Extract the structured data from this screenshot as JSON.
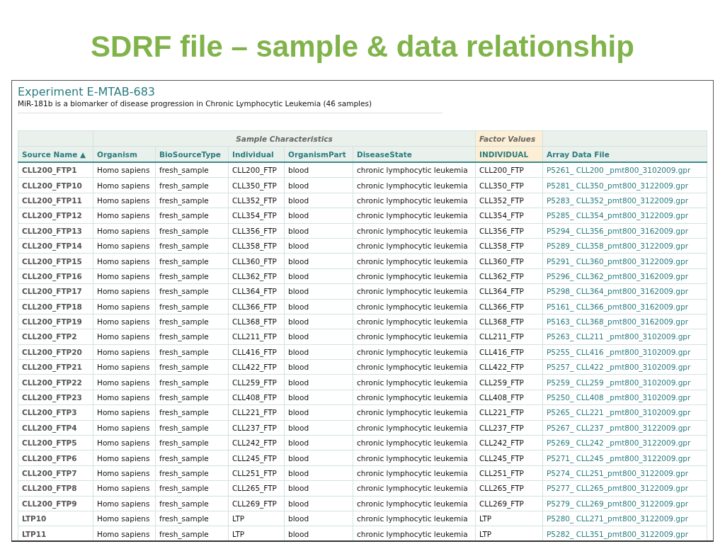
{
  "slide_title": "SDRF file – sample & data relationship",
  "experiment": {
    "title": "Experiment E-MTAB-683",
    "description": "MiR-181b is a biomarker of disease progression in Chronic Lymphocytic Leukemia (46 samples)"
  },
  "table": {
    "group_headers": [
      {
        "label": "Sample Characteristics",
        "kind": "characteristics"
      },
      {
        "label": "Factor Values",
        "kind": "factor"
      }
    ],
    "columns": [
      {
        "label": "Source Name",
        "kind": "source",
        "sort_indicator": "▲"
      },
      {
        "label": "Organism",
        "kind": "characteristics"
      },
      {
        "label": "BioSourceType",
        "kind": "characteristics"
      },
      {
        "label": "Individual",
        "kind": "characteristics"
      },
      {
        "label": "OrganismPart",
        "kind": "characteristics"
      },
      {
        "label": "DiseaseState",
        "kind": "characteristics"
      },
      {
        "label": "INDIVIDUAL",
        "kind": "factor"
      },
      {
        "label": "Array Data File",
        "kind": "file"
      }
    ],
    "rows": [
      [
        "CLL200_FTP1",
        "Homo sapiens",
        "fresh_sample",
        "CLL200_FTP",
        "blood",
        "chronic lymphocytic leukemia",
        "CLL200_FTP",
        "P5261_ CLL200 _pmt800_3102009.gpr"
      ],
      [
        "CLL200_FTP10",
        "Homo sapiens",
        "fresh_sample",
        "CLL350_FTP",
        "blood",
        "chronic lymphocytic leukemia",
        "CLL350_FTP",
        "P5281_ CLL350_pmt800_3122009.gpr"
      ],
      [
        "CLL200_FTP11",
        "Homo sapiens",
        "fresh_sample",
        "CLL352_FTP",
        "blood",
        "chronic lymphocytic leukemia",
        "CLL352_FTP",
        "P5283_ CLL352_pmt800_3122009.gpr"
      ],
      [
        "CLL200_FTP12",
        "Homo sapiens",
        "fresh_sample",
        "CLL354_FTP",
        "blood",
        "chronic lymphocytic leukemia",
        "CLL354_FTP",
        "P5285_ CLL354_pmt800_3122009.gpr"
      ],
      [
        "CLL200_FTP13",
        "Homo sapiens",
        "fresh_sample",
        "CLL356_FTP",
        "blood",
        "chronic lymphocytic leukemia",
        "CLL356_FTP",
        "P5294_ CLL356_pmt800_3162009.gpr"
      ],
      [
        "CLL200_FTP14",
        "Homo sapiens",
        "fresh_sample",
        "CLL358_FTP",
        "blood",
        "chronic lymphocytic leukemia",
        "CLL358_FTP",
        "P5289_ CLL358_pmt800_3122009.gpr"
      ],
      [
        "CLL200_FTP15",
        "Homo sapiens",
        "fresh_sample",
        "CLL360_FTP",
        "blood",
        "chronic lymphocytic leukemia",
        "CLL360_FTP",
        "P5291_ CLL360_pmt800_3122009.gpr"
      ],
      [
        "CLL200_FTP16",
        "Homo sapiens",
        "fresh_sample",
        "CLL362_FTP",
        "blood",
        "chronic lymphocytic leukemia",
        "CLL362_FTP",
        "P5296_ CLL362_pmt800_3162009.gpr"
      ],
      [
        "CLL200_FTP17",
        "Homo sapiens",
        "fresh_sample",
        "CLL364_FTP",
        "blood",
        "chronic lymphocytic leukemia",
        "CLL364_FTP",
        "P5298_ CLL364_pmt800_3162009.gpr"
      ],
      [
        "CLL200_FTP18",
        "Homo sapiens",
        "fresh_sample",
        "CLL366_FTP",
        "blood",
        "chronic lymphocytic leukemia",
        "CLL366_FTP",
        "P5161_ CLL366_pmt800_3162009.gpr"
      ],
      [
        "CLL200_FTP19",
        "Homo sapiens",
        "fresh_sample",
        "CLL368_FTP",
        "blood",
        "chronic lymphocytic leukemia",
        "CLL368_FTP",
        "P5163_ CLL368_pmt800_3162009.gpr"
      ],
      [
        "CLL200_FTP2",
        "Homo sapiens",
        "fresh_sample",
        "CLL211_FTP",
        "blood",
        "chronic lymphocytic leukemia",
        "CLL211_FTP",
        "P5263_ CLL211 _pmt800_3102009.gpr"
      ],
      [
        "CLL200_FTP20",
        "Homo sapiens",
        "fresh_sample",
        "CLL416_FTP",
        "blood",
        "chronic lymphocytic leukemia",
        "CLL416_FTP",
        "P5255_ CLL416 _pmt800_3102009.gpr"
      ],
      [
        "CLL200_FTP21",
        "Homo sapiens",
        "fresh_sample",
        "CLL422_FTP",
        "blood",
        "chronic lymphocytic leukemia",
        "CLL422_FTP",
        "P5257_ CLL422 _pmt800_3102009.gpr"
      ],
      [
        "CLL200_FTP22",
        "Homo sapiens",
        "fresh_sample",
        "CLL259_FTP",
        "blood",
        "chronic lymphocytic leukemia",
        "CLL259_FTP",
        "P5259_ CLL259 _pmt800_3102009.gpr"
      ],
      [
        "CLL200_FTP23",
        "Homo sapiens",
        "fresh_sample",
        "CLL408_FTP",
        "blood",
        "chronic lymphocytic leukemia",
        "CLL408_FTP",
        "P5250_ CLL408 _pmt800_3102009.gpr"
      ],
      [
        "CLL200_FTP3",
        "Homo sapiens",
        "fresh_sample",
        "CLL221_FTP",
        "blood",
        "chronic lymphocytic leukemia",
        "CLL221_FTP",
        "P5265_ CLL221 _pmt800_3102009.gpr"
      ],
      [
        "CLL200_FTP4",
        "Homo sapiens",
        "fresh_sample",
        "CLL237_FTP",
        "blood",
        "chronic lymphocytic leukemia",
        "CLL237_FTP",
        "P5267_ CLL237 _pmt800_3122009.gpr"
      ],
      [
        "CLL200_FTP5",
        "Homo sapiens",
        "fresh_sample",
        "CLL242_FTP",
        "blood",
        "chronic lymphocytic leukemia",
        "CLL242_FTP",
        "P5269_ CLL242 _pmt800_3122009.gpr"
      ],
      [
        "CLL200_FTP6",
        "Homo sapiens",
        "fresh_sample",
        "CLL245_FTP",
        "blood",
        "chronic lymphocytic leukemia",
        "CLL245_FTP",
        "P5271_ CLL245 _pmt800_3122009.gpr"
      ],
      [
        "CLL200_FTP7",
        "Homo sapiens",
        "fresh_sample",
        "CLL251_FTP",
        "blood",
        "chronic lymphocytic leukemia",
        "CLL251_FTP",
        "P5274_ CLL251_pmt800_3122009.gpr"
      ],
      [
        "CLL200_FTP8",
        "Homo sapiens",
        "fresh_sample",
        "CLL265_FTP",
        "blood",
        "chronic lymphocytic leukemia",
        "CLL265_FTP",
        "P5277_ CLL265_pmt800_3122009.gpr"
      ],
      [
        "CLL200_FTP9",
        "Homo sapiens",
        "fresh_sample",
        "CLL269_FTP",
        "blood",
        "chronic lymphocytic leukemia",
        "CLL269_FTP",
        "P5279_ CLL269_pmt800_3122009.gpr"
      ],
      [
        "LTP10",
        "Homo sapiens",
        "fresh_sample",
        "LTP",
        "blood",
        "chronic lymphocytic leukemia",
        "LTP",
        "P5280_ CLL271_pmt800_3122009.gpr"
      ],
      [
        "LTP11",
        "Homo sapiens",
        "fresh_sample",
        "LTP",
        "blood",
        "chronic lymphocytic leukemia",
        "LTP",
        "P5282_ CLL351_pmt800_3122009.gpr"
      ]
    ]
  }
}
